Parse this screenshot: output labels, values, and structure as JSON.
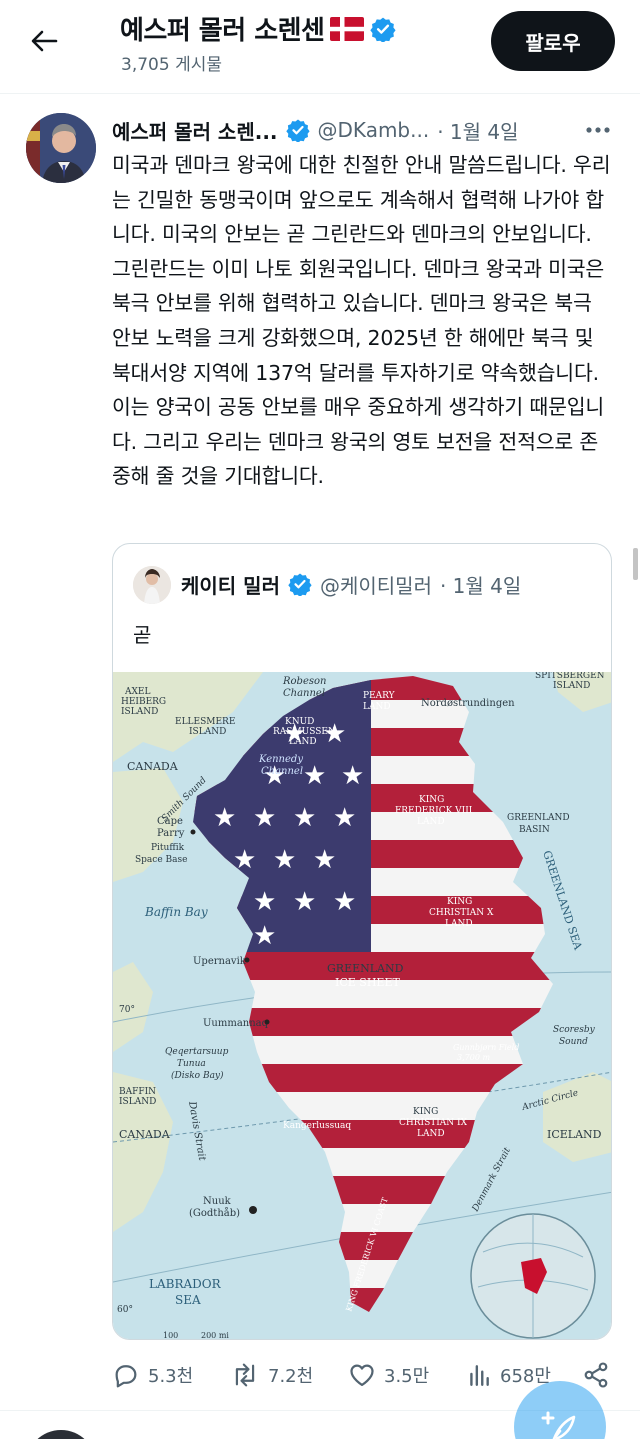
{
  "header": {
    "title": "예스퍼 몰러 소렌센",
    "post_count": "3,705 게시물",
    "follow_label": "팔로우"
  },
  "tweet": {
    "author_name": "예스퍼 몰러 소렌...",
    "handle": "@DKamb...",
    "date": "· 1월 4일",
    "text": "미국과 덴마크 왕국에 대한 친절한 안내 말씀드립니다. 우리는 긴밀한 동맹국이며 앞으로도 계속해서 협력해 나가야 합니다. 미국의 안보는 곧 그린란드와 덴마크의 안보입니다. 그린란드는 이미 나토 회원국입니다. 덴마크 왕국과 미국은 북극 안보를 위해 협력하고 있습니다. 덴마크 왕국은 북극 안보 노력을 크게 강화했으며, 2025년 한 해에만 북극 및 북대서양 지역에 137억 달러를 투자하기로 약속했습니다. 이는 양국이 공동 안보를 매우 중요하게 생각하기 때문입니다. 그리고 우리는 덴마크 왕국의 영토 보전을 전적으로 존중해 줄 것을 기대합니다."
  },
  "quote": {
    "author_name": "케이티 밀러",
    "handle": "@케이티밀러",
    "date": "· 1월 4일",
    "text": "곧"
  },
  "map_labels": {
    "robeson": "Robeson",
    "channel": "Channel",
    "peary": "PEARY",
    "land": "LAND",
    "nordostrundingen": "Nordøstrundingen",
    "spitsbergen": "SPITSBERGEN",
    "island": "ISLAND",
    "axel": "AXEL",
    "heiberg": "HEIBERG",
    "ellesmere": "ELLESMERE",
    "knud": "KNUD",
    "rasmussen": "RASMUSSEN",
    "kennedy": "Kennedy",
    "canada": "CANADA",
    "smith_sound": "Smith Sound",
    "cape": "Cape",
    "parry": "Parry",
    "pituffik": "Pituffik",
    "space_base": "Space Base",
    "king": "KING",
    "frederick_viii": "FREDERICK VIII",
    "greenland": "GREENLAND",
    "basin": "BASIN",
    "baffin_bay": "Baffin Bay",
    "christian_x": "CHRISTIAN X",
    "greenland_sea": "GREENLAND SEA",
    "upernavik": "Upernavik",
    "ice_sheet": "ICE SHEET",
    "deg70": "70°",
    "uummannaq": "Uummannaq",
    "scoresby": "Scoresby",
    "sound": "Sound",
    "qeqertarsuup": "Qeqertarsuup",
    "tunua": "Tunua",
    "disko_bay": "(Disko Bay)",
    "gunnbjorn": "Gunnbjørn Field",
    "gunnbjorn_alt": "3,700 m",
    "baffin": "BAFFIN",
    "davis_strait": "Davis Strait",
    "arctic_circle": "Arctic Circle",
    "kangerlussuaq": "Kangerlussuaq",
    "christian_ix": "CHRISTIAN IX",
    "iceland": "ICELAND",
    "nuuk": "Nuuk",
    "godthab": "(Godthåb)",
    "denmark_strait": "Denmark Strait",
    "frederick_vi_coast": "KING FREDERICK VI COAST",
    "labrador": "LABRADOR",
    "sea": "SEA",
    "deg60": "60°",
    "scale_100": "100",
    "scale_200": "200 mi"
  },
  "actions": {
    "replies": "5.3천",
    "reposts": "7.2천",
    "likes": "3.5만",
    "views": "658만"
  },
  "colors": {
    "accent": "#1d9bf0",
    "text": "#0f1419",
    "muted": "#536471",
    "flag_red": "#b3203a",
    "flag_blue": "#3c3b6e",
    "denmark_red": "#c8102e"
  },
  "icons": [
    "back-arrow-icon",
    "denmark-flag-icon",
    "verified-badge-icon",
    "more-icon",
    "reply-icon",
    "repost-icon",
    "like-icon",
    "views-icon",
    "share-icon",
    "compose-icon"
  ]
}
